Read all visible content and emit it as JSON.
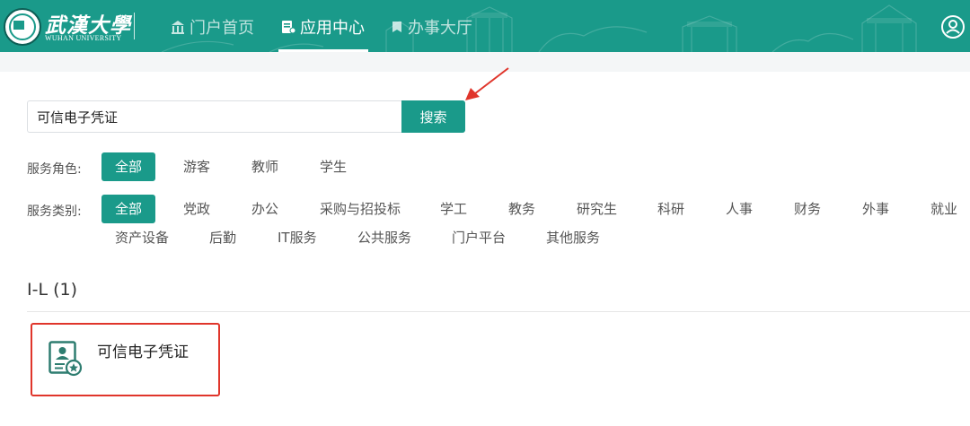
{
  "header": {
    "logo_cn": "武漢大學",
    "logo_en": "WUHAN UNIVERSITY",
    "nav": [
      {
        "label": "门户首页",
        "icon": "building-icon"
      },
      {
        "label": "应用中心",
        "icon": "app-center-icon"
      },
      {
        "label": "办事大厅",
        "icon": "bookmark-icon"
      }
    ],
    "active_nav": "应用中心",
    "user_icon": "user-circle-icon"
  },
  "search": {
    "value": "可信电子凭证",
    "button_label": "搜索"
  },
  "filters": {
    "role": {
      "label": "服务角色:",
      "options": [
        "全部",
        "游客",
        "教师",
        "学生"
      ],
      "selected": "全部"
    },
    "category": {
      "label": "服务类别:",
      "options_row1": [
        "全部",
        "党政",
        "办公",
        "采购与招投标",
        "学工",
        "教务",
        "研究生",
        "科研",
        "人事",
        "财务",
        "外事",
        "就业"
      ],
      "options_row2": [
        "资产设备",
        "后勤",
        "IT服务",
        "公共服务",
        "门户平台",
        "其他服务"
      ],
      "selected": "全部"
    }
  },
  "results": {
    "group_title": "I-L (1)",
    "apps": [
      {
        "name": "可信电子凭证",
        "icon": "credential-icon"
      }
    ]
  },
  "colors": {
    "brand": "#1a9a8a",
    "annotation": "#e0352b"
  }
}
